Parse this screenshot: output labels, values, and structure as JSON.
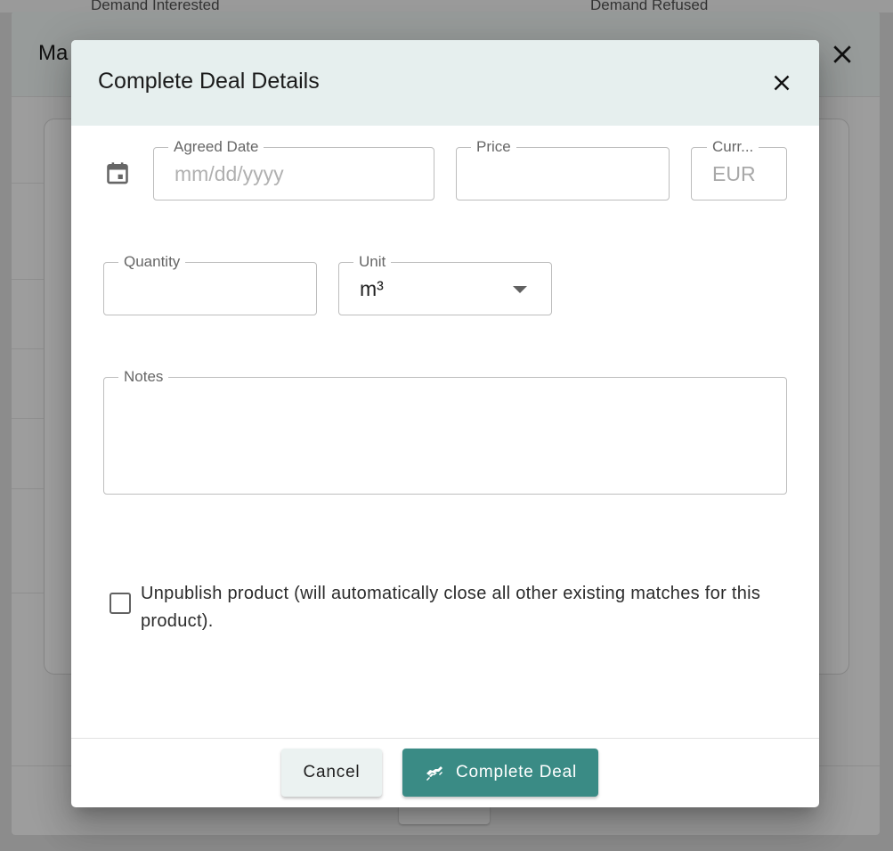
{
  "background": {
    "column_left": "Demand Interested",
    "column_right": "Demand Refused",
    "dialog_title_partial": "Ma"
  },
  "modal": {
    "title": "Complete Deal Details",
    "close_icon": "close-icon"
  },
  "form": {
    "agreed_date": {
      "label": "Agreed Date",
      "placeholder": "mm/dd/yyyy",
      "value": "",
      "icon": "calendar-icon"
    },
    "price": {
      "label": "Price",
      "value": ""
    },
    "currency": {
      "label": "Curr...",
      "value": "EUR"
    },
    "quantity": {
      "label": "Quantity",
      "value": ""
    },
    "unit": {
      "label": "Unit",
      "value": "m³"
    },
    "notes": {
      "label": "Notes",
      "value": ""
    },
    "unpublish": {
      "label": "Unpublish product (will automatically close all other existing matches for this product).",
      "checked": false
    }
  },
  "footer": {
    "cancel_label": "Cancel",
    "complete_label": "Complete Deal",
    "complete_icon": "handshake-icon"
  },
  "colors": {
    "header_bg": "#e6efee",
    "primary": "#3a8b85",
    "cancel_bg": "#ebf2f1"
  }
}
